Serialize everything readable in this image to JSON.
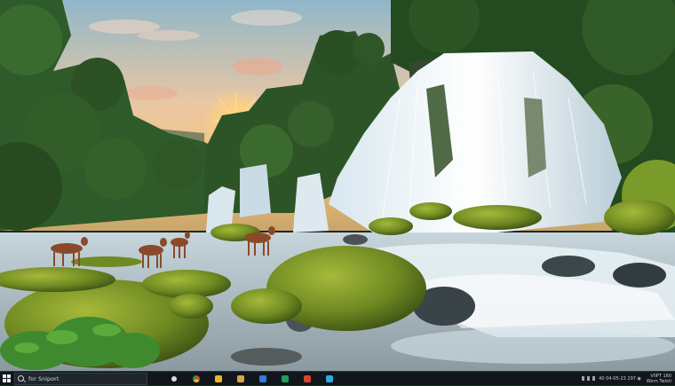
{
  "taskbar": {
    "search_placeholder": "for Sniport",
    "apps": [
      {
        "icon": "search-icon",
        "color": "#d8dde0"
      },
      {
        "icon": "chrome-icon",
        "color": "#e6a31a"
      },
      {
        "icon": "file-explorer-icon",
        "color": "#f0b429"
      },
      {
        "icon": "store-icon",
        "color": "#d9a441"
      },
      {
        "icon": "mail-icon",
        "color": "#2d7de0"
      },
      {
        "icon": "excel-icon",
        "color": "#1f9d55"
      },
      {
        "icon": "office-icon",
        "color": "#d9432f"
      },
      {
        "icon": "photos-icon",
        "color": "#2aa9e0"
      }
    ],
    "tray_text": "40 04-05-23 297 ◉",
    "clock_line1": "VIIPT 160",
    "clock_line2": "Worn Twisti"
  },
  "wallpaper": {
    "subject": "waterfall-landscape",
    "colors": {
      "sky_top": "#8fb7c9",
      "sun": "#ffd27a",
      "foliage": "#2f5a2a",
      "moss": "#7a9a2a",
      "water": "#e9f2f6",
      "deer": "#8a4a2a"
    }
  }
}
